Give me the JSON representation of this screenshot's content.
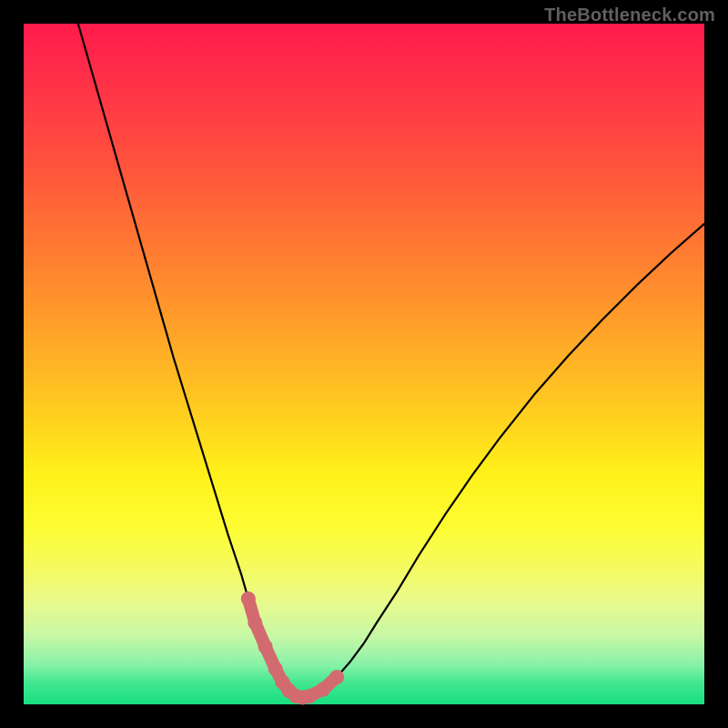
{
  "watermark": "TheBottleneck.com",
  "chart_data": {
    "type": "line",
    "title": "",
    "xlabel": "",
    "ylabel": "",
    "xlim": [
      0,
      100
    ],
    "ylim": [
      0,
      100
    ],
    "grid": false,
    "legend": false,
    "series": [
      {
        "name": "bottleneck-curve",
        "color": "#000000",
        "x": [
          8,
          10,
          12,
          14,
          16,
          18,
          20,
          22,
          24,
          26,
          28,
          30,
          32,
          33,
          34,
          35.5,
          37,
          38,
          39,
          40,
          41,
          42,
          44,
          46,
          48,
          50,
          52,
          55,
          58,
          62,
          66,
          70,
          75,
          80,
          85,
          90,
          95,
          100
        ],
        "values": [
          100,
          93,
          86,
          79,
          72,
          65,
          58,
          51,
          44.5,
          38,
          31.5,
          25,
          19,
          15.5,
          12,
          8.5,
          5.2,
          3.3,
          2.0,
          1.2,
          1.0,
          1.2,
          2.2,
          4.0,
          6.3,
          9.0,
          12.2,
          16.8,
          21.8,
          28.0,
          33.8,
          39.2,
          45.5,
          51.2,
          56.5,
          61.5,
          66.2,
          70.6
        ]
      },
      {
        "name": "highlight-minimum",
        "color": "#d36a6f",
        "x": [
          33,
          34,
          35.5,
          37,
          38,
          39,
          40,
          41,
          42,
          44,
          46
        ],
        "values": [
          15.5,
          12,
          8.5,
          5.2,
          3.3,
          2.0,
          1.2,
          1.0,
          1.2,
          2.2,
          4.0
        ]
      }
    ],
    "annotations": []
  }
}
